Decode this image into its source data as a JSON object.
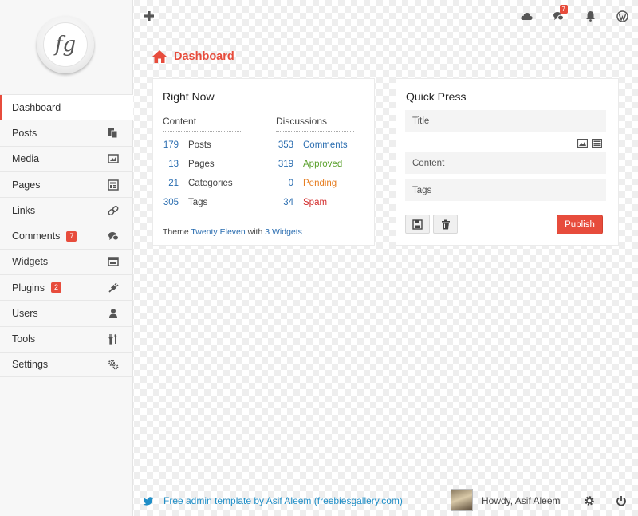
{
  "sidebar": {
    "logo_text": "fg",
    "items": [
      {
        "label": "Dashboard",
        "icon": "",
        "badge": ""
      },
      {
        "label": "Posts",
        "icon": "posts-icon",
        "badge": ""
      },
      {
        "label": "Media",
        "icon": "media-icon",
        "badge": ""
      },
      {
        "label": "Pages",
        "icon": "pages-icon",
        "badge": ""
      },
      {
        "label": "Links",
        "icon": "link-icon",
        "badge": ""
      },
      {
        "label": "Comments",
        "icon": "comments-icon",
        "badge": "7"
      },
      {
        "label": "Widgets",
        "icon": "widgets-icon",
        "badge": ""
      },
      {
        "label": "Plugins",
        "icon": "plugin-icon",
        "badge": "2"
      },
      {
        "label": "Users",
        "icon": "user-icon",
        "badge": ""
      },
      {
        "label": "Tools",
        "icon": "tools-icon",
        "badge": ""
      },
      {
        "label": "Settings",
        "icon": "gears-icon",
        "badge": ""
      }
    ]
  },
  "topbar": {
    "comments_badge": "7",
    "icons": [
      "plus-icon",
      "cloud-icon",
      "comments-icon",
      "bell-icon",
      "wordpress-icon"
    ]
  },
  "header": {
    "title": "Dashboard"
  },
  "right_now": {
    "title": "Right Now",
    "content_heading": "Content",
    "discussions_heading": "Discussions",
    "content": [
      {
        "num": "179",
        "label": "Posts"
      },
      {
        "num": "13",
        "label": "Pages"
      },
      {
        "num": "21",
        "label": "Categories"
      },
      {
        "num": "305",
        "label": "Tags"
      }
    ],
    "discussions": [
      {
        "num": "353",
        "label": "Comments",
        "color": "#2a6db0"
      },
      {
        "num": "319",
        "label": "Approved",
        "color": "#5aa02c"
      },
      {
        "num": "0",
        "label": "Pending",
        "color": "#e67e22"
      },
      {
        "num": "34",
        "label": "Spam",
        "color": "#d32f2f"
      }
    ],
    "theme_prefix": "Theme",
    "theme_name": "Twenty Eleven",
    "theme_with": "with",
    "widgets_link": "3 Widgets"
  },
  "quick_press": {
    "title": "Quick Press",
    "title_placeholder": "Title",
    "content_placeholder": "Content",
    "tags_placeholder": "Tags",
    "publish_label": "Publish"
  },
  "footer": {
    "link_text": "Free admin template by Asif Aleem (freebiesgallery.com)",
    "howdy": "Howdy, Asif Aleem"
  },
  "colors": {
    "accent": "#e74c3c",
    "link": "#2a6db0",
    "footer_link": "#1f8ec7"
  }
}
